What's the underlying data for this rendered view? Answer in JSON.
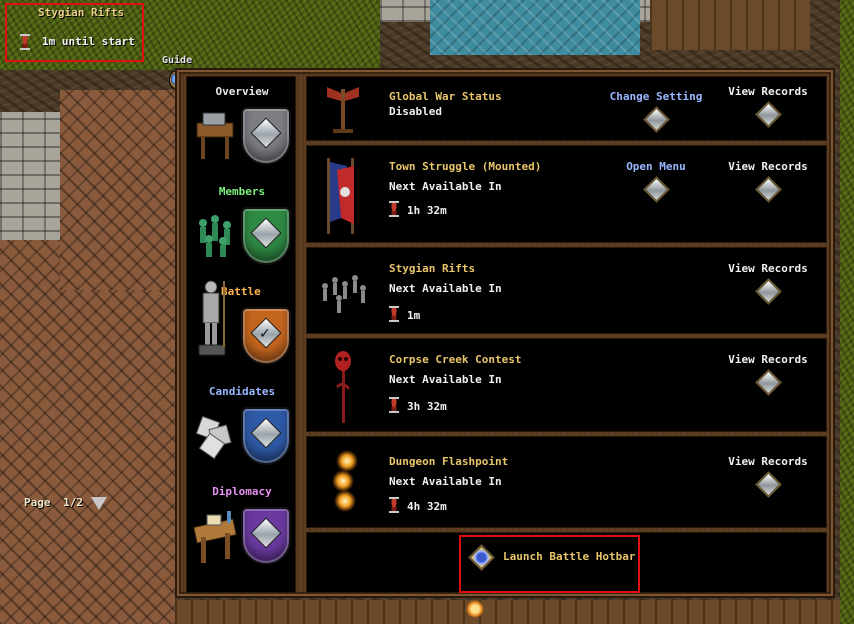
{
  "status": {
    "event_name": "Stygian Rifts",
    "countdown": "1m until start"
  },
  "guide_label": "Guide",
  "sidebar": {
    "sections": [
      {
        "label": "Overview",
        "color": "#e6e6e6",
        "crest_color": "#7d7d84"
      },
      {
        "label": "Members",
        "color": "#7cf07c",
        "crest_color": "#2f8a44"
      },
      {
        "label": "Battle",
        "color": "#ffb347",
        "crest_color": "#c4651e"
      },
      {
        "label": "Candidates",
        "color": "#9ab8ff",
        "crest_color": "#2f5aa8"
      },
      {
        "label": "Diplomacy",
        "color": "#e58ef0",
        "crest_color": "#6a3aa0"
      }
    ],
    "page_label": "Page",
    "page_value": "1/2"
  },
  "entries": [
    {
      "name": "Global War Status",
      "sub": "Disabled",
      "time": "",
      "icon": "banner-axe-icon",
      "primary_action": "Change Setting",
      "secondary_action": "View Records"
    },
    {
      "name": "Town Struggle (Mounted)",
      "sub": "Next Available In",
      "time": "1h 32m",
      "icon": "war-banners-icon",
      "primary_action": "Open Menu",
      "secondary_action": "View Records"
    },
    {
      "name": "Stygian Rifts",
      "sub": "Next Available In",
      "time": "1m",
      "icon": "soldiers-icon",
      "primary_action": "",
      "secondary_action": "View Records"
    },
    {
      "name": "Corpse Creek Contest",
      "sub": "Next Available In",
      "time": "3h 32m",
      "icon": "skull-staff-icon",
      "primary_action": "",
      "secondary_action": "View Records"
    },
    {
      "name": "Dungeon Flashpoint",
      "sub": "Next Available In",
      "time": "4h 32m",
      "icon": "flames-icon",
      "primary_action": "",
      "secondary_action": "View Records"
    }
  ],
  "launch_label": "Launch Battle Hotbar"
}
